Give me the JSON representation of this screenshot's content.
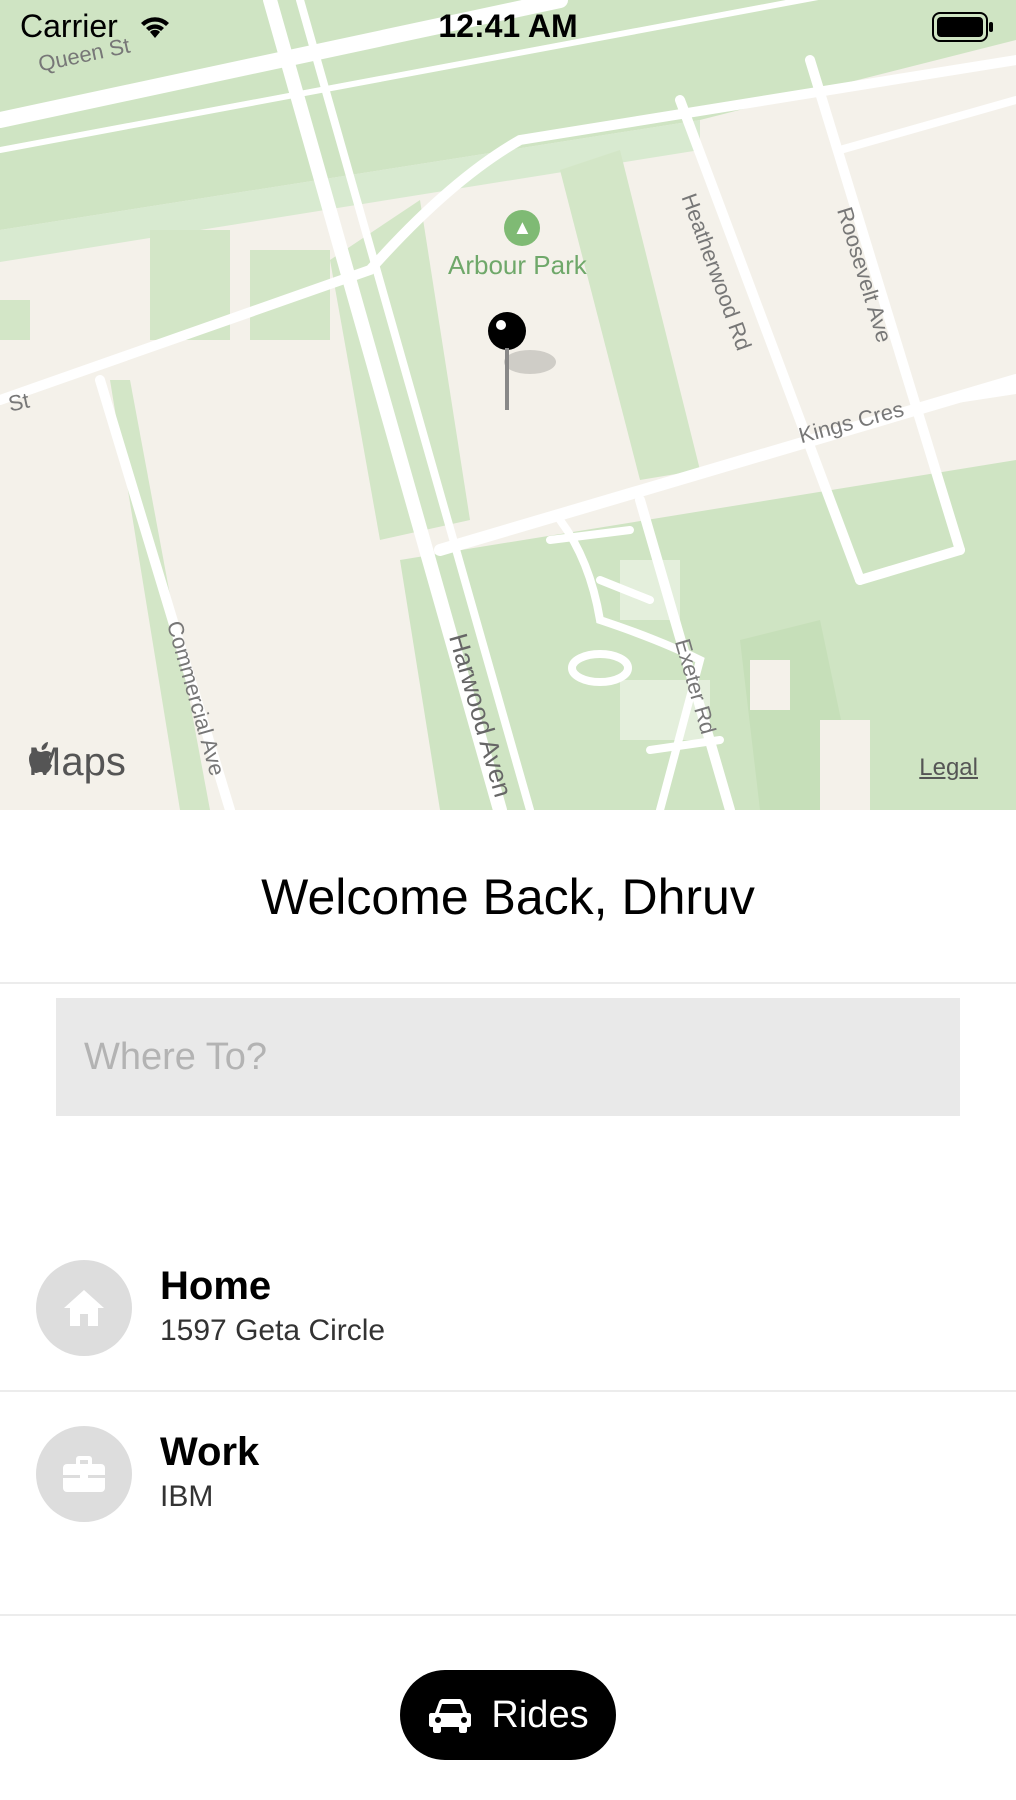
{
  "status_bar": {
    "carrier": "Carrier",
    "time": "12:41 AM"
  },
  "map": {
    "park_label": "Arbour Park",
    "street_labels": [
      "Queen St",
      "St",
      "Heatherwood Rd",
      "Roosevelt Ave",
      "Kings Cres",
      "Commercial Ave",
      "Harwood Aven",
      "Exeter Rd"
    ],
    "logo_text": "Maps",
    "legal_label": "Legal"
  },
  "welcome": {
    "title": "Welcome Back, Dhruv"
  },
  "search": {
    "placeholder": "Where To?",
    "value": ""
  },
  "saved_places": [
    {
      "name": "Home",
      "address": "1597 Geta Circle",
      "icon": "home-icon"
    },
    {
      "name": "Work",
      "address": "IBM",
      "icon": "briefcase-icon"
    }
  ],
  "rides_button": {
    "label": "Rides",
    "icon": "car-icon"
  },
  "colors": {
    "map_land": "#f4f1ea",
    "map_green": "#cde3c0",
    "accent": "#000000",
    "field_bg": "#e9e9e9",
    "icon_circle": "#dddddd"
  }
}
